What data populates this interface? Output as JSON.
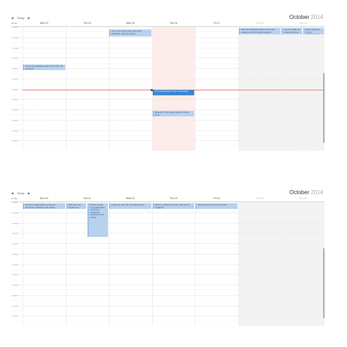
{
  "app": {
    "today_label": "Today",
    "prev_icon": "chevron-left-icon",
    "next_icon": "chevron-right-icon",
    "all_day_label": "all-day"
  },
  "weeks": [
    {
      "title_month": "October",
      "title_year": "2014",
      "days": [
        {
          "label": "Mon 13",
          "weekend": false,
          "today": false
        },
        {
          "label": "Tue 14",
          "weekend": false,
          "today": false
        },
        {
          "label": "Wed 15",
          "weekend": false,
          "today": false
        },
        {
          "label": "Thu 16",
          "weekend": false,
          "today": true
        },
        {
          "label": "Fri 17",
          "weekend": false,
          "today": false
        },
        {
          "label": "Sat 18",
          "weekend": true,
          "today": false
        },
        {
          "label": "Sun 19",
          "weekend": true,
          "today": false
        }
      ],
      "time_labels": [
        "9 AM",
        "10 AM",
        "11 AM",
        "Noon",
        "1 PM",
        "2 PM",
        "3 PM",
        "4 PM",
        "5 PM",
        "6 PM",
        "7 PM",
        "8 PM"
      ],
      "events": [
        {
          "day": 2,
          "text": "Go to the recipe page and select chocolate cake as dessert",
          "selected": false
        },
        {
          "day": 0,
          "text": "Check the guideline page and review the next plan",
          "selected": false
        },
        {
          "day": 3,
          "text": "Go to the launch for the construction",
          "selected": true
        },
        {
          "day": 3,
          "text": "Research new target audience at the store",
          "selected": false
        },
        {
          "day": 5,
          "text": "Meet an Instagram account and new audience for the target audience",
          "selected": false
        },
        {
          "day": 6,
          "text": "Go to go with the target audience",
          "selected": false
        },
        {
          "day": 6,
          "text": "Meet audience for the announcement",
          "selected": false
        }
      ]
    },
    {
      "title_month": "October",
      "title_year": "2014",
      "days": [
        {
          "label": "Mon 20",
          "weekend": false,
          "today": false
        },
        {
          "label": "Tue 21",
          "weekend": false,
          "today": false
        },
        {
          "label": "Wed 22",
          "weekend": false,
          "today": false
        },
        {
          "label": "Thu 23",
          "weekend": false,
          "today": false
        },
        {
          "label": "Fri 24",
          "weekend": false,
          "today": false
        },
        {
          "label": "Sat 25",
          "weekend": true,
          "today": false
        },
        {
          "label": "Sun 26",
          "weekend": true,
          "today": false
        }
      ],
      "time_labels": [
        "9 AM",
        "10 AM",
        "11 AM",
        "Noon",
        "1 PM",
        "2 PM",
        "3 PM",
        "4 PM",
        "5 PM",
        "6 PM",
        "7 PM",
        "8 PM"
      ],
      "events": [
        {
          "day": 0,
          "text": "Meet the organization of science, architects, industries and profits",
          "selected": false
        },
        {
          "day": 1,
          "text": "Meet the new department",
          "selected": false
        },
        {
          "day": 1,
          "text": "Follow up with the organization of science, marketing, customers and money",
          "selected": false
        },
        {
          "day": 2,
          "text": "Follow up with the new department",
          "selected": false
        },
        {
          "day": 3,
          "text": "Follow up with the known style for the magazine",
          "selected": false
        },
        {
          "day": 4,
          "text": "Meet friend for the construction",
          "selected": false
        }
      ]
    }
  ]
}
